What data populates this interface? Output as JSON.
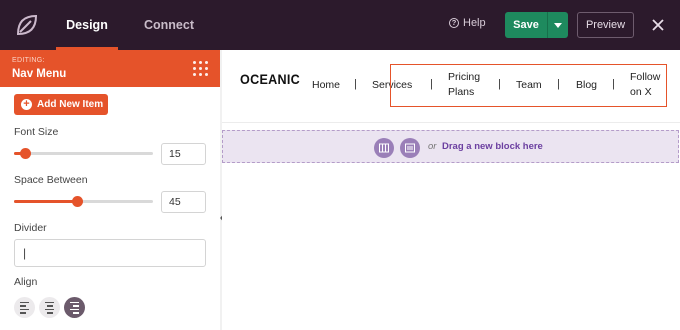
{
  "topbar": {
    "tabs": [
      {
        "label": "Design",
        "active": true
      },
      {
        "label": "Connect",
        "active": false
      }
    ],
    "help_label": "Help",
    "save_label": "Save",
    "preview_label": "Preview"
  },
  "sidebar": {
    "editing_label": "EDITING:",
    "title": "Nav Menu",
    "add_item_label": "Add New Item",
    "font_size": {
      "label": "Font Size",
      "value": "15",
      "slider_fraction": 0.08
    },
    "space_between": {
      "label": "Space Between",
      "value": "45",
      "slider_fraction": 0.45
    },
    "divider": {
      "label": "Divider",
      "value": "|"
    },
    "align": {
      "label": "Align",
      "options": [
        "left",
        "center",
        "right"
      ],
      "selected": "right"
    }
  },
  "canvas": {
    "site_logo": "OCEANIC",
    "nav_items": [
      "Home",
      "Services",
      "Pricing\nPlans",
      "Team",
      "Blog",
      "Follow\non X"
    ],
    "separator": "|",
    "dropzone": {
      "or_label": "or",
      "text": "Drag a new block here"
    }
  },
  "colors": {
    "accent": "#e5532a",
    "topbar_bg": "#2c1a2c",
    "save_green": "#1e8a5e",
    "dropzone_bg": "#ebe4f1",
    "dropzone_icon": "#9a7fb8"
  },
  "icons": [
    "seedprod-leaf-icon",
    "help-icon",
    "chevron-down-icon",
    "close-icon",
    "drag-handle-icon",
    "plus-circle-icon",
    "align-left-icon",
    "align-center-icon",
    "align-right-icon",
    "collapse-arrow-icon",
    "columns-icon",
    "block-icon"
  ]
}
